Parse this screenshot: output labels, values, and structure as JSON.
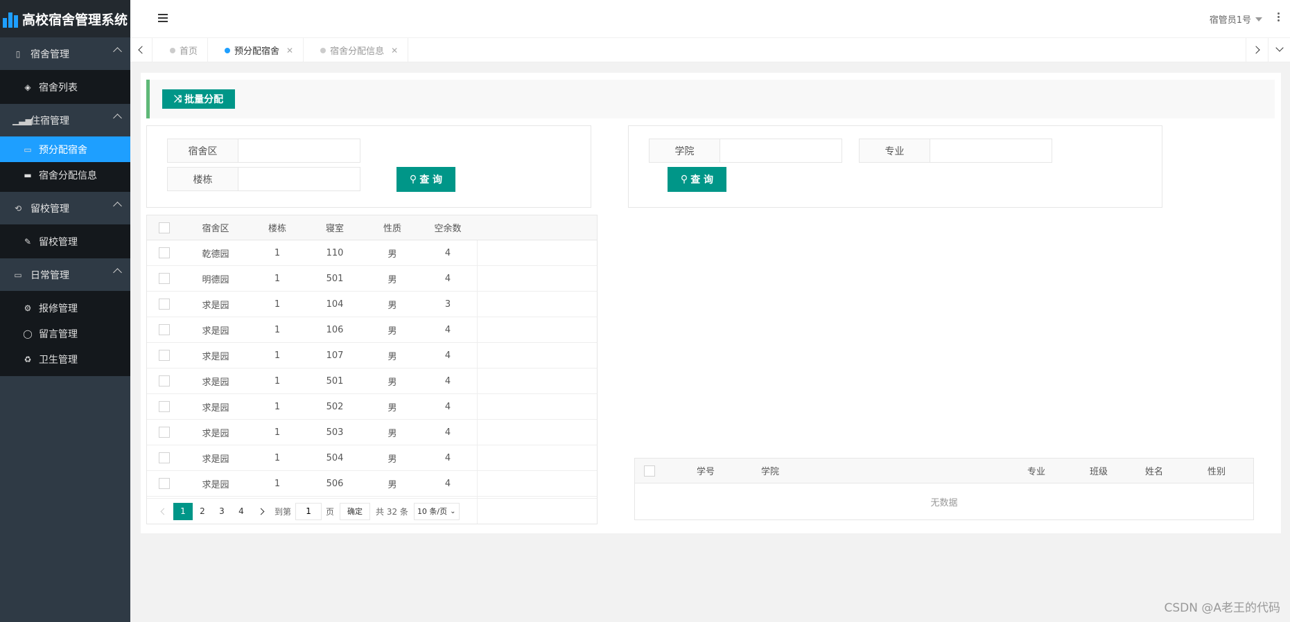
{
  "app": {
    "title": "高校宿舍管理系统"
  },
  "sidebar": {
    "groups": [
      {
        "label": "宿舍管理",
        "items": [
          {
            "label": "宿舍列表"
          }
        ]
      },
      {
        "label": "住宿管理",
        "items": [
          {
            "label": "预分配宿舍"
          },
          {
            "label": "宿舍分配信息"
          }
        ]
      },
      {
        "label": "留校管理",
        "items": [
          {
            "label": "留校管理"
          }
        ]
      },
      {
        "label": "日常管理",
        "items": [
          {
            "label": "报修管理"
          },
          {
            "label": "留言管理"
          },
          {
            "label": "卫生管理"
          }
        ]
      }
    ],
    "active_item": "预分配宿舍"
  },
  "header": {
    "user": "宿管员1号"
  },
  "tabs": [
    {
      "label": "首页"
    },
    {
      "label": "预分配宿舍"
    },
    {
      "label": "宿舍分配信息"
    }
  ],
  "toolbar": {
    "batch_label": "批量分配"
  },
  "left_search": {
    "field1_label": "宿舍区",
    "field1_value": "",
    "field2_label": "楼栋",
    "field2_value": "",
    "query_label": "查 询"
  },
  "right_search": {
    "field1_label": "学院",
    "field1_value": "",
    "field2_label": "专业",
    "field2_value": "",
    "query_label": "查 询"
  },
  "dorm_table": {
    "columns": [
      "宿舍区",
      "楼栋",
      "寝室",
      "性质",
      "空余数"
    ],
    "rows": [
      [
        "乾德园",
        "1",
        "110",
        "男",
        "4"
      ],
      [
        "明德园",
        "1",
        "501",
        "男",
        "4"
      ],
      [
        "求是园",
        "1",
        "104",
        "男",
        "3"
      ],
      [
        "求是园",
        "1",
        "106",
        "男",
        "4"
      ],
      [
        "求是园",
        "1",
        "107",
        "男",
        "4"
      ],
      [
        "求是园",
        "1",
        "501",
        "男",
        "4"
      ],
      [
        "求是园",
        "1",
        "502",
        "男",
        "4"
      ],
      [
        "求是园",
        "1",
        "503",
        "男",
        "4"
      ],
      [
        "求是园",
        "1",
        "504",
        "男",
        "4"
      ],
      [
        "求是园",
        "1",
        "506",
        "男",
        "4"
      ]
    ]
  },
  "pager": {
    "pages": [
      "1",
      "2",
      "3",
      "4"
    ],
    "goto_prefix": "到第",
    "goto_value": "1",
    "goto_suffix": "页",
    "confirm_label": "确定",
    "total_text": "共 32 条",
    "page_size": "10 条/页"
  },
  "student_table": {
    "columns": [
      "学号",
      "学院",
      "专业",
      "班级",
      "姓名",
      "性别"
    ],
    "empty_text": "无数据"
  },
  "watermark": "CSDN @A老王的代码",
  "colors": {
    "accent": "#009688",
    "active_nav": "#1e9fff",
    "sidebar": "#2f3a45",
    "submenu": "#14181c"
  }
}
